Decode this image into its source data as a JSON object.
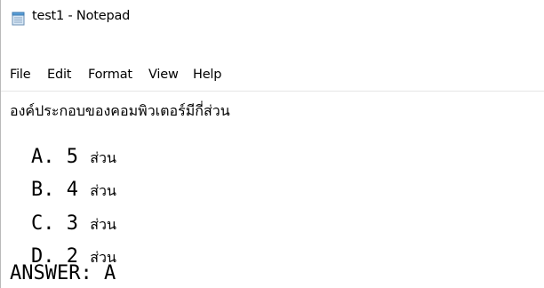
{
  "window": {
    "title": "test1 - Notepad",
    "icon": "notepad-icon"
  },
  "menu": {
    "items": [
      "File",
      "Edit",
      "Format",
      "View",
      "Help"
    ]
  },
  "document": {
    "question": "องค์ประกอบของคอมพิวเตอร์มีกี่ส่วน",
    "options": [
      {
        "prefix": "A. 5 ",
        "text": "ส่วน"
      },
      {
        "prefix": "B. 4 ",
        "text": "ส่วน"
      },
      {
        "prefix": "C. 3 ",
        "text": "ส่วน"
      },
      {
        "prefix": "D. 2 ",
        "text": "ส่วน"
      }
    ],
    "answer": "ANSWER: A"
  }
}
